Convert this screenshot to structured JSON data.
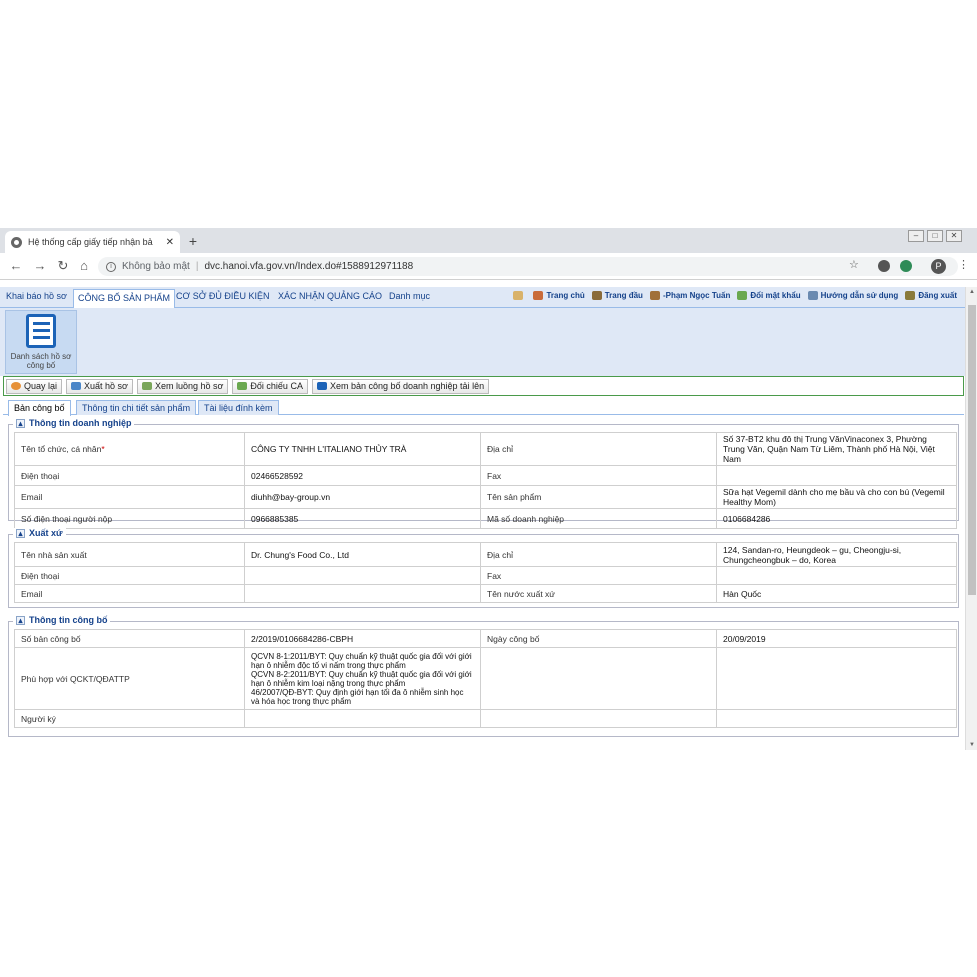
{
  "browser": {
    "tab_title": "Hệ thống cấp giấy tiếp nhận bả",
    "close_glyph": "✕",
    "newtab_glyph": "+",
    "security_label": "Không bảo mật",
    "url": "dvc.hanoi.vfa.gov.vn/Index.do#1588912971188",
    "avatar_letter": "P"
  },
  "appnav": {
    "tabs": [
      "Khai báo hồ sơ",
      "CÔNG BỐ SẢN PHẨM",
      "CƠ SỞ ĐỦ ĐIỀU KIỆN",
      "XÁC NHẬN QUẢNG CÁO",
      "Danh mục"
    ],
    "right": [
      "Trang chủ",
      "Trang đầu",
      "-Phạm Ngọc Tuấn",
      "Đổi mật khẩu",
      "Hướng dẫn sử dụng",
      "Đăng xuất"
    ]
  },
  "ribbon": {
    "button_label": "Danh sách hồ sơ công bố"
  },
  "toolbar": {
    "buttons": [
      "Quay lại",
      "Xuất hồ sơ",
      "Xem luồng hồ sơ",
      "Đối chiếu CA",
      "Xem bản công bố doanh nghiệp tải lên"
    ]
  },
  "tabs": [
    "Bản công bố",
    "Thông tin chi tiết sản phẩm",
    "Tài liệu đính kèm"
  ],
  "sections": {
    "business": {
      "title": "Thông tin doanh nghiệp",
      "rows": [
        [
          "Tên tổ chức, cá nhân",
          "CÔNG TY TNHH L'ITALIANO THỦY TRÀ",
          "Địa chỉ",
          "Số 37-BT2 khu đô thị Trung VănVinaconex 3, Phường Trung Văn, Quận Nam Từ Liêm, Thành phố Hà Nội, Việt Nam"
        ],
        [
          "Điện thoại",
          "02466528592",
          "Fax",
          ""
        ],
        [
          "Email",
          "diuhh@bay-group.vn",
          "Tên sản phẩm",
          "Sữa hạt Vegemil dành cho mẹ bầu và cho con bú (Vegemil Healthy Mom)"
        ],
        [
          "Số điện thoại người nộp",
          "0966885385",
          "Mã số doanh nghiệp",
          "0106684286"
        ]
      ],
      "required_mark": "*"
    },
    "origin": {
      "title": "Xuất xứ",
      "rows": [
        [
          "Tên nhà sản xuất",
          "Dr. Chung's Food Co., Ltd",
          "Địa chỉ",
          "124, Sandan-ro, Heungdeok – gu, Cheongju-si, Chungcheongbuk – do, Korea"
        ],
        [
          "Điện thoại",
          "",
          "Fax",
          ""
        ],
        [
          "Email",
          "",
          "Tên nước xuất xứ",
          "Hàn Quốc"
        ]
      ]
    },
    "publication": {
      "title": "Thông tin công bố",
      "rows": [
        [
          "Số bản công bố",
          "2/2019/0106684286-CBPH",
          "Ngày công bố",
          "20/09/2019"
        ],
        [
          "Phù hợp với QCKT/QĐATTP",
          "QCVN 8-1:2011/BYT: Quy chuẩn kỹ thuật quốc gia đối với giới hạn ô nhiễm độc tố vi nấm trong thực phẩm\nQCVN 8-2:2011/BYT: Quy chuẩn kỹ thuật quốc gia đối với giới hạn ô nhiễm kim loại nặng trong thực phẩm\n46/2007/QĐ-BYT: Quy định giới hạn tối đa ô nhiễm sinh học và hóa học trong thực phẩm",
          "",
          ""
        ],
        [
          "Người ký",
          "",
          "",
          ""
        ]
      ]
    }
  },
  "colors": {
    "link_blue": "#15428b",
    "panel_bg": "#dfe8f6",
    "border_blue": "#99bbe8",
    "toolbar_border": "#4a9a4a"
  },
  "icons": [
    "globe-icon",
    "back-arrow-icon",
    "forward-arrow-icon",
    "reload-icon",
    "home-icon",
    "info-icon",
    "star-icon",
    "document-list-icon"
  ]
}
